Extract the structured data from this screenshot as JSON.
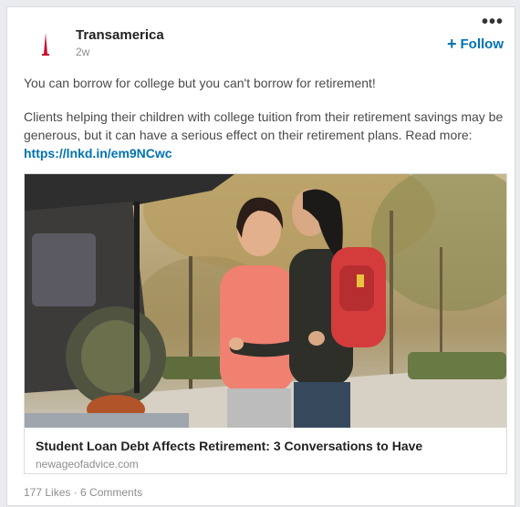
{
  "post": {
    "company": "Transamerica",
    "time": "2w",
    "follow_label": "Follow",
    "follow_icon": "+",
    "more_icon": "•••",
    "text_line1": "You can borrow for college but you can't borrow for retirement!",
    "text_line2": "Clients helping their children with college tuition from their retirement savings may be generous, but it can have a serious effect on their retirement plans. Read more: ",
    "link": "https://lnkd.in/em9NCwc"
  },
  "article": {
    "title": "Student Loan Debt Affects Retirement: 3 Conversations to Have",
    "source": "newageofadvice.com"
  },
  "social": {
    "likes": "177 Likes",
    "separator": " · ",
    "comments": "6 Comments"
  },
  "colors": {
    "brand_red": "#c8102e",
    "link_blue": "#0073b1"
  }
}
